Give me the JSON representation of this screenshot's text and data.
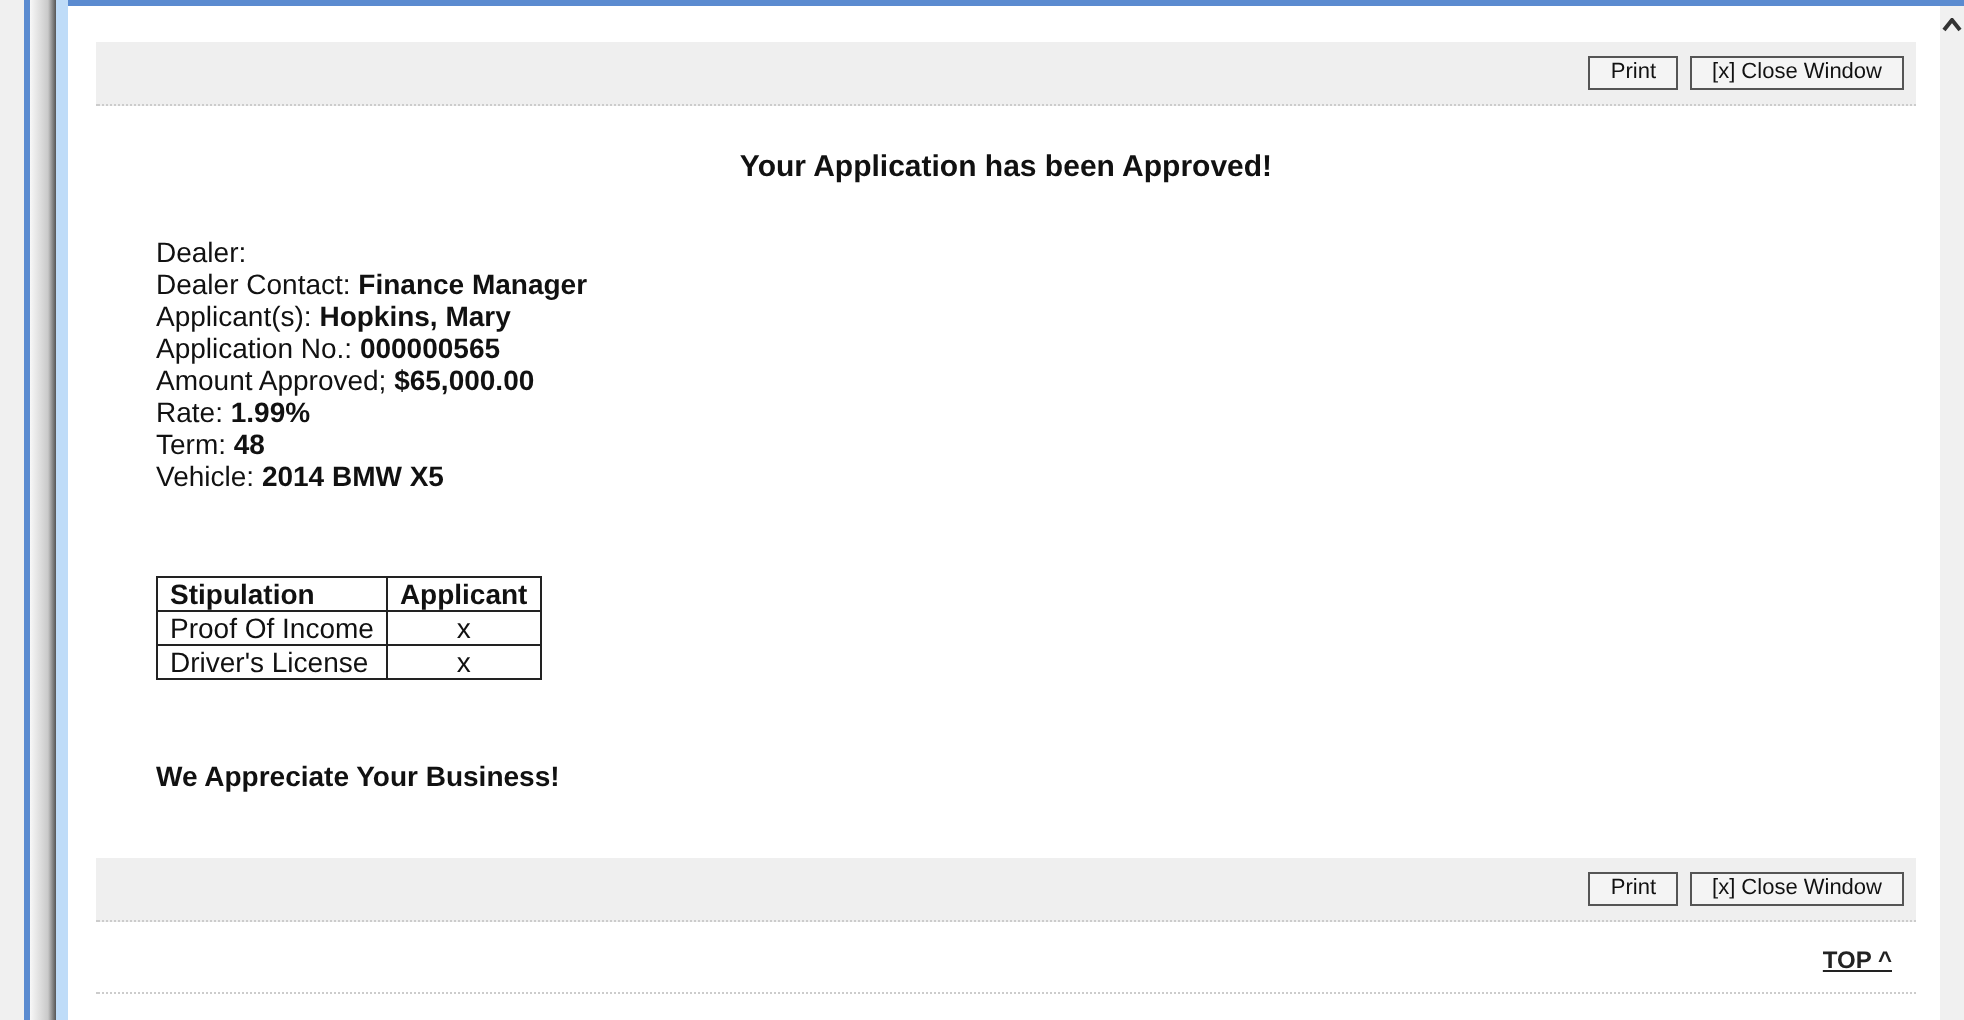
{
  "toolbar_top": {
    "buttons": [
      "Print",
      "[x] Close Window"
    ]
  },
  "heading": "Your Application has been Approved!",
  "details": [
    {
      "label": "Dealer:"
    },
    {
      "label": "Dealer Contact:",
      "value": "Finance Manager"
    },
    {
      "label": "Applicant(s):",
      "value": "Hopkins, Mary"
    },
    {
      "label": "Application No.:",
      "value": "000000565"
    },
    {
      "label": "Amount Approved; ",
      "value": "$65,000.00"
    },
    {
      "label": "Rate:",
      "value": "1.99%"
    },
    {
      "label": "Term:",
      "value": "48"
    },
    {
      "label": "Vehicle:",
      "value": "2014 BMW X5"
    }
  ],
  "stipulations": {
    "columns": [
      "Stipulation",
      "Applicant"
    ],
    "rows": [
      [
        "Proof Of Income",
        "x"
      ],
      [
        "Driver's License",
        "x"
      ]
    ]
  },
  "closing": "We Appreciate Your Business!",
  "toolbar_bottom": {
    "buttons": [
      "Print",
      "[x] Close Window"
    ]
  },
  "top_link": "TOP ^"
}
